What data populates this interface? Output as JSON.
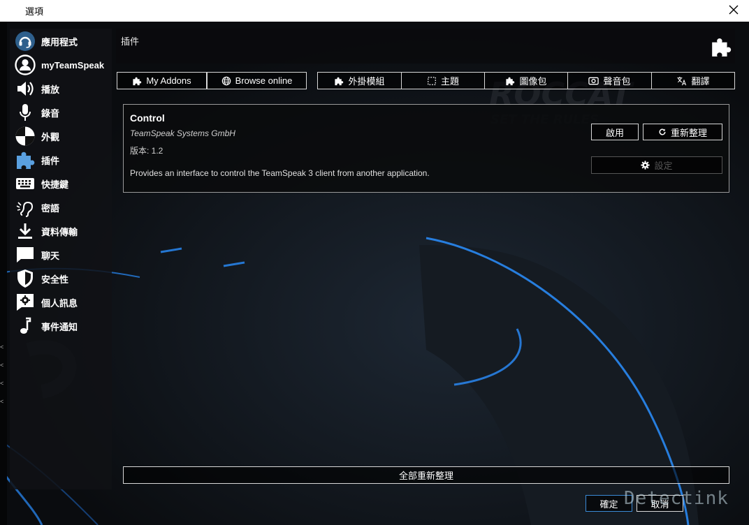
{
  "window": {
    "title": "選項"
  },
  "sidebar": {
    "items": [
      {
        "label": "應用程式",
        "icon": "headset-icon"
      },
      {
        "label": "myTeamSpeak",
        "icon": "user-icon"
      },
      {
        "label": "播放",
        "icon": "speaker-icon"
      },
      {
        "label": "錄音",
        "icon": "microphone-icon"
      },
      {
        "label": "外觀",
        "icon": "appearance-icon"
      },
      {
        "label": "插件",
        "icon": "puzzle-icon"
      },
      {
        "label": "快捷鍵",
        "icon": "keyboard-icon"
      },
      {
        "label": "密語",
        "icon": "ear-icon"
      },
      {
        "label": "資料傳輸",
        "icon": "download-icon"
      },
      {
        "label": "聊天",
        "icon": "chat-icon"
      },
      {
        "label": "安全性",
        "icon": "shield-icon"
      },
      {
        "label": "個人訊息",
        "icon": "settings-message-icon"
      },
      {
        "label": "事件通知",
        "icon": "music-note-icon"
      }
    ],
    "selected": "插件"
  },
  "panel": {
    "title": "插件",
    "header_icon": "puzzle-icon"
  },
  "tabs": [
    {
      "label": "My Addons",
      "icon": "puzzle-icon"
    },
    {
      "label": "Browse online",
      "icon": "globe-icon"
    },
    {
      "label": "外掛模組",
      "icon": "puzzle-icon"
    },
    {
      "label": "主題",
      "icon": "theme-icon"
    },
    {
      "label": "圖像包",
      "icon": "puzzle-icon"
    },
    {
      "label": "聲音包",
      "icon": "sound-pack-icon"
    },
    {
      "label": "翻譯",
      "icon": "translate-icon"
    }
  ],
  "addon": {
    "name": "Control",
    "author": "TeamSpeak Systems GmbH",
    "version": "版本: 1.2",
    "description": "Provides an interface to control the TeamSpeak 3 client from another application.",
    "enable_label": "啟用",
    "reload_label": "重新整理",
    "settings_label": "設定"
  },
  "footer": {
    "reload_all_label": "全部重新整理",
    "ok_label": "確定",
    "cancel_label": "取消"
  },
  "watermark": "Detectink",
  "colors": {
    "accent": "#3a8ad6",
    "border": "#d8d8d8",
    "panel": "#0a0b0d"
  }
}
